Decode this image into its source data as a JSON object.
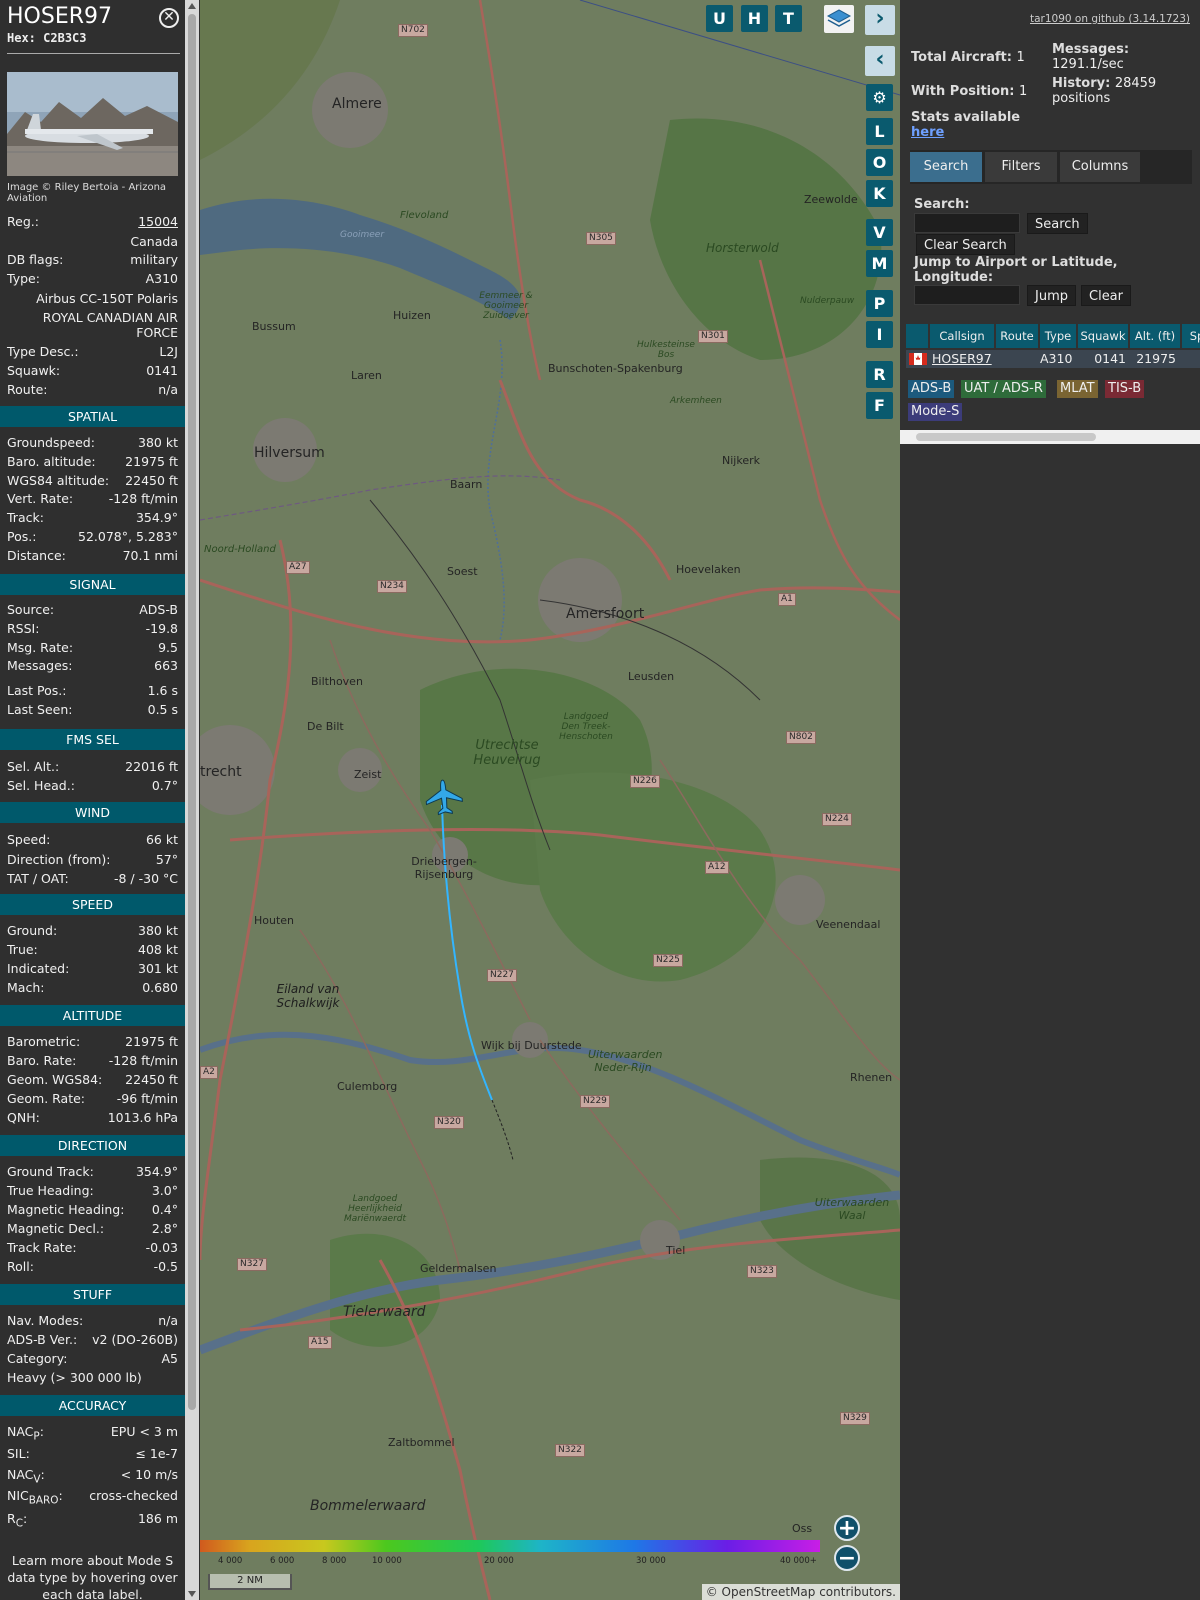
{
  "aircraft": {
    "callsign": "HOSER97",
    "hex_label": "Hex:",
    "hex": "C2B3C3",
    "photo_credit": "Image © Riley Bertoia - Arizona Aviation",
    "reg_label": "Reg.:",
    "reg": "15004",
    "country": "Canada",
    "dbflags_label": "DB flags:",
    "dbflags": "military",
    "type_label": "Type:",
    "type": "A310",
    "type_name": "Airbus CC-150T Polaris",
    "operator_line1": "ROYAL CANADIAN AIR",
    "operator_line2": "FORCE",
    "typedesc_label": "Type Desc.:",
    "typedesc": "L2J",
    "squawk_label": "Squawk:",
    "squawk": "0141",
    "route_label": "Route:",
    "route": "n/a"
  },
  "sections": {
    "spatial": "SPATIAL",
    "signal": "SIGNAL",
    "fms": "FMS SEL",
    "wind": "WIND",
    "speed": "SPEED",
    "altitude": "ALTITUDE",
    "direction": "DIRECTION",
    "stuff": "STUFF",
    "accuracy": "ACCURACY"
  },
  "spatial": [
    {
      "k": "Groundspeed:",
      "v": "380 kt"
    },
    {
      "k": "Baro. altitude:",
      "v": "21975 ft"
    },
    {
      "k": "WGS84 altitude:",
      "v": "22450 ft"
    },
    {
      "k": "Vert. Rate:",
      "v": "-128 ft/min"
    },
    {
      "k": "Track:",
      "v": "354.9°"
    },
    {
      "k": "Pos.:",
      "v": "52.078°, 5.283°"
    },
    {
      "k": "Distance:",
      "v": "70.1 nmi"
    }
  ],
  "signal": [
    {
      "k": "Source:",
      "v": "ADS-B"
    },
    {
      "k": "RSSI:",
      "v": "-19.8"
    },
    {
      "k": "Msg. Rate:",
      "v": "9.5"
    },
    {
      "k": "Messages:",
      "v": "663"
    },
    {
      "k": "Last Pos.:",
      "v": "1.6 s"
    },
    {
      "k": "Last Seen:",
      "v": "0.5 s"
    }
  ],
  "fms": [
    {
      "k": "Sel. Alt.:",
      "v": "22016 ft"
    },
    {
      "k": "Sel. Head.:",
      "v": "0.7°"
    }
  ],
  "wind": [
    {
      "k": "Speed:",
      "v": "66 kt"
    },
    {
      "k": "Direction (from):",
      "v": "57°"
    },
    {
      "k": "TAT / OAT:",
      "v": "-8 / -30 °C"
    }
  ],
  "speed": [
    {
      "k": "Ground:",
      "v": "380 kt"
    },
    {
      "k": "True:",
      "v": "408 kt"
    },
    {
      "k": "Indicated:",
      "v": "301 kt"
    },
    {
      "k": "Mach:",
      "v": "0.680"
    }
  ],
  "altitude": [
    {
      "k": "Barometric:",
      "v": "21975 ft"
    },
    {
      "k": "Baro. Rate:",
      "v": "-128 ft/min"
    },
    {
      "k": "Geom. WGS84:",
      "v": "22450 ft"
    },
    {
      "k": "Geom. Rate:",
      "v": "-96 ft/min"
    },
    {
      "k": "QNH:",
      "v": "1013.6 hPa"
    }
  ],
  "direction": [
    {
      "k": "Ground Track:",
      "v": "354.9°"
    },
    {
      "k": "True Heading:",
      "v": "3.0°"
    },
    {
      "k": "Magnetic Heading:",
      "v": "0.4°"
    },
    {
      "k": "Magnetic Decl.:",
      "v": "2.8°"
    },
    {
      "k": "Track Rate:",
      "v": "-0.03"
    },
    {
      "k": "Roll:",
      "v": "-0.5"
    }
  ],
  "stuff": {
    "navmodes_label": "Nav. Modes:",
    "navmodes": "n/a",
    "adsbver_label": "ADS-B Ver.:",
    "adsbver": "v2 (DO-260B)",
    "category_label": "Category:",
    "category": "A5",
    "category_desc": "Heavy (> 300 000 lb)"
  },
  "accuracy": {
    "nacp_label": "NAC",
    "nacp_sub": "P",
    "nacp": "EPU < 3 m",
    "sil_label": "SIL:",
    "sil": "≤ 1e-7",
    "nacv_label": "NAC",
    "nacv_sub": "V",
    "nacv": "< 10 m/s",
    "nic_label": "NIC",
    "nic_sub": "BARO",
    "nic": "cross-checked",
    "rc_label": "R",
    "rc_sub": "C",
    "rc": "186 m"
  },
  "note": "Learn more about Mode S data type by hovering over each data label.",
  "map": {
    "top_buttons": [
      "U",
      "H",
      "T"
    ],
    "side_buttons": [
      "L",
      "O",
      "K",
      "V",
      "M",
      "P",
      "I",
      "R",
      "F"
    ],
    "scale": "2 NM",
    "attribution_prefix": "© ",
    "attribution_link": "OpenStreetMap",
    "attribution_suffix": " contributors.",
    "legend_labels": [
      "4 000",
      "6 000",
      "8 000",
      "10 000",
      "20 000",
      "30 000",
      "40 000+"
    ],
    "places": [
      "Almere",
      "Huizen",
      "Bussum",
      "Laren",
      "Hilversum",
      "Baarn",
      "Soest",
      "Amersfoort",
      "Hoevelaken",
      "Nijkerk",
      "Bunschoten-Spakenburg",
      "Leusden",
      "Bilthoven",
      "De Bilt",
      "Zeist",
      "Driebergen-Rijsenburg",
      "Houten",
      "Veenendaal",
      "Wijk bij Duurstede",
      "Culemborg",
      "Rhenen",
      "Geldermalsen",
      "Tiel",
      "Zaltbommel",
      "Oss",
      "Zeewolde",
      "trecht",
      "Tielerwaard",
      "Bommelerwaard",
      "Utrechtse Heuvelrug",
      "Horsterwold",
      "Eiland van Schalkwijk",
      "Flevoland",
      "Noord-Holland",
      "Gooimeer",
      "Eemmeer & Gooimeer Zuidoever",
      "Hulkesteinse Bos",
      "Arkemheen",
      "Landgoed Den Treek-Henschoten",
      "Uiterwaarden Neder-Rijn",
      "Landgoed Heerlijkheid Mariënwaerdt",
      "Uiterwaarden Waal",
      "Nulderpauw"
    ],
    "roads": [
      "N702",
      "N305",
      "N301",
      "A27",
      "N234",
      "A1",
      "N802",
      "N226",
      "N224",
      "A12",
      "N225",
      "N227",
      "N229",
      "N320",
      "A2",
      "N327",
      "N323",
      "A15",
      "N322",
      "N329"
    ]
  },
  "right": {
    "github": "tar1090 on github (3.14.1723)",
    "total_label": "Total Aircraft:",
    "total": "1",
    "withpos_label": "With Position:",
    "withpos": "1",
    "messages_label": "Messages:",
    "messages": "1291.1/sec",
    "history_label": "History:",
    "history": "28459",
    "history_unit": "positions",
    "stats_label": "Stats available",
    "stats_link": "here",
    "tabs": [
      "Search",
      "Filters",
      "Columns"
    ],
    "search_label": "Search:",
    "search_btn": "Search",
    "clear_search_btn": "Clear Search",
    "jump_label": "Jump to Airport or Latitude, Longitude:",
    "jump_btn": "Jump",
    "clear_btn": "Clear",
    "columns": [
      "Callsign",
      "Route",
      "Type",
      "Squawk",
      "Alt. (ft)",
      "Sp"
    ],
    "row": {
      "callsign": "HOSER97",
      "route": "",
      "type": "A310",
      "squawk": "0141",
      "alt": "21975"
    },
    "sources": [
      "ADS-B",
      "UAT / ADS-R",
      "MLAT",
      "TIS-B",
      "Mode-S"
    ]
  },
  "colors": {
    "section_bg": "#00596b",
    "button_bg": "#0a5a6e",
    "track": "#33b5ff",
    "adsb": "#1c5a7e",
    "uat": "#2e6b3a",
    "mlat": "#7a6432",
    "tisb": "#7a2a34",
    "modes": "#3c3c7a"
  }
}
